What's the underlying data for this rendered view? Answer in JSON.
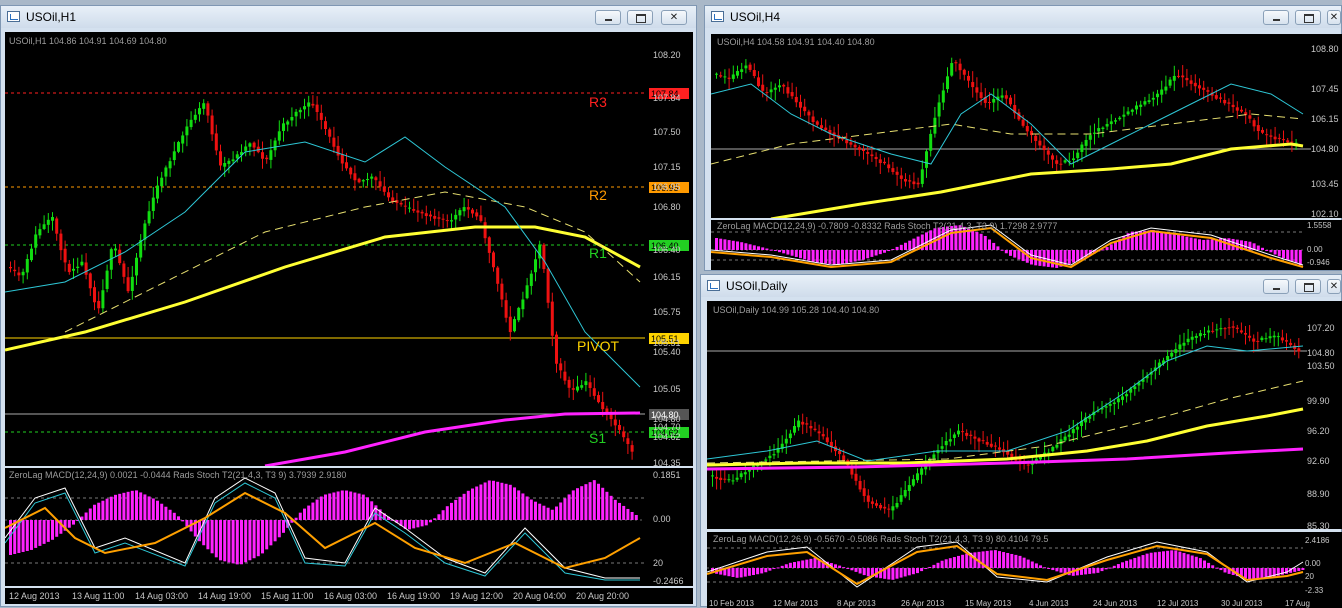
{
  "windows": {
    "h1": {
      "title": "USOil,H1",
      "info": "USOil,H1  104.86 104.91 104.69 104.80",
      "prices": [
        "108.20",
        "107.84",
        "107.50",
        "107.15",
        "106.95",
        "106.80",
        "106.40",
        "106.15",
        "105.75",
        "105.51",
        "105.40",
        "105.05",
        "104.80",
        "104.70",
        "104.62",
        "104.35"
      ],
      "levels": {
        "r3": "R3",
        "r2": "R2",
        "r1": "R1",
        "pivot": "PIVOT",
        "s1": "S1"
      },
      "indicator": "ZeroLag MACD(12,24,9) 0.0021 -0.0444  Rads Stoch T2(21,4,3, T3 9) 3.7939 2.9180",
      "ind_axis": [
        "0.1851",
        "0.00",
        "20",
        "-0.2466"
      ],
      "dates": [
        "12 Aug 2013",
        "13 Aug 11:00",
        "14 Aug 03:00",
        "14 Aug 19:00",
        "15 Aug 11:00",
        "16 Aug 03:00",
        "16 Aug 19:00",
        "19 Aug 12:00",
        "20 Aug 04:00",
        "20 Aug 20:00"
      ]
    },
    "h4": {
      "title": "USOil,H4",
      "info": "USOil,H4  104.58 104.91 104.40 104.80",
      "prices": [
        "108.80",
        "107.45",
        "106.15",
        "104.80",
        "103.45",
        "102.10"
      ],
      "indicator": "ZeroLag MACD(12,24,9) -0.7809 -0.8332  Rads Stoch T2(21,4,3, T3 9) 1.7298 2.9777",
      "ind_axis": [
        "1.5558",
        "0.00",
        "20",
        "-0.946"
      ]
    },
    "daily": {
      "title": "USOil,Daily",
      "info": "USOil,Daily  104.99 105.28 104.40 104.80",
      "prices": [
        "107.20",
        "104.80",
        "103.50",
        "99.90",
        "96.20",
        "92.60",
        "88.90",
        "85.30"
      ],
      "indicator": "ZeroLag MACD(12,26,9) -0.5670 -0.5086  Rads Stoch T2(21,4,3, T3 9) 80.4104 79.5",
      "ind_axis": [
        "2.4186",
        "0.00",
        "20",
        "-2.33"
      ],
      "dates": [
        "10 Feb 2013",
        "12 Mar 2013",
        "8 Apr 2013",
        "26 Apr 2013",
        "15 May 2013",
        "4 Jun 2013",
        "24 Jun 2013",
        "12 Jul 2013",
        "30 Jul 2013",
        "17 Aug"
      ]
    }
  },
  "colors": {
    "r3": "#ff2020",
    "r2": "#ff9a00",
    "r1": "#22d022",
    "pivot": "#ffd400",
    "s1": "#22d022",
    "ma_fast": "#2ec7d6",
    "ma_slow": "#ffff33",
    "ma_200": "#ff22ff",
    "bull": "#11dd11",
    "bear": "#ee1111",
    "hist": "#ff22ff"
  }
}
